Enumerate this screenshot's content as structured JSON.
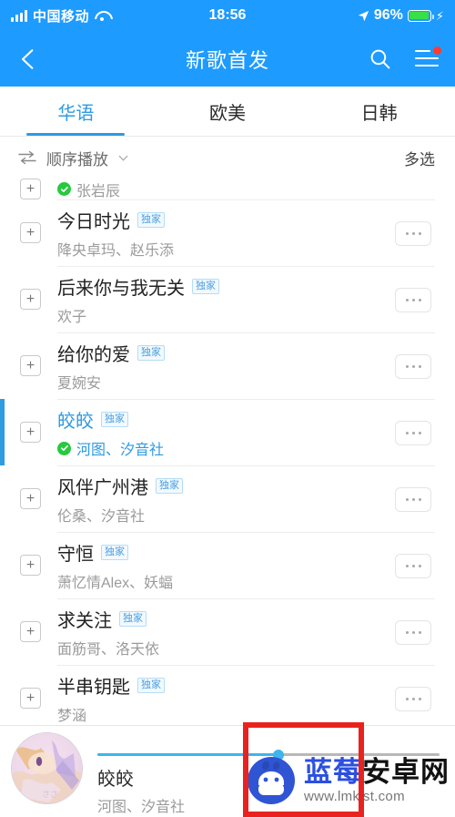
{
  "status_bar": {
    "signal_icon": "signal-bars-icon",
    "carrier": "中国移动",
    "wifi_icon": "wifi-icon",
    "time": "18:56",
    "location_icon": "location-arrow-icon",
    "battery_percent": "96%",
    "battery_level": 96,
    "battery_icon": "battery-icon",
    "charging_icon": "charging-bolt-icon"
  },
  "header": {
    "back_icon": "back-chevron-icon",
    "title": "新歌首发",
    "search_icon": "search-icon",
    "menu_icon": "hamburger-menu-icon",
    "menu_badge": true,
    "background_color": "#1e9bff"
  },
  "tabs": {
    "active_index": 0,
    "items": [
      {
        "label": "华语"
      },
      {
        "label": "欧美"
      },
      {
        "label": "日韩"
      }
    ],
    "active_color": "#2f9be0"
  },
  "toolbar": {
    "sequence_icon": "sequential-play-icon",
    "play_mode": "顺序播放",
    "caret_icon": "chevron-down-icon",
    "multi_select": "多选"
  },
  "list": {
    "partial_top_row": {
      "artist": "张岩辰",
      "verified": true
    },
    "badge_label": "独家",
    "add_icon": "plus-icon",
    "more_icon": "more-horizontal-icon",
    "songs": [
      {
        "title": "今日时光",
        "artist": "降央卓玛、赵乐添",
        "exclusive": true,
        "verified": false,
        "playing": false
      },
      {
        "title": "后来你与我无关",
        "artist": "欢子",
        "exclusive": true,
        "verified": false,
        "playing": false
      },
      {
        "title": "给你的爱",
        "artist": "夏婉安",
        "exclusive": true,
        "verified": false,
        "playing": false
      },
      {
        "title": "皎皎",
        "artist": "河图、汐音社",
        "exclusive": true,
        "verified": true,
        "playing": true
      },
      {
        "title": "风伴广州港",
        "artist": "伦桑、汐音社",
        "exclusive": true,
        "verified": false,
        "playing": false
      },
      {
        "title": "守恒",
        "artist": "萧忆情Alex、妖蝠",
        "exclusive": true,
        "verified": false,
        "playing": false
      },
      {
        "title": "求关注",
        "artist": "面筋哥、洛天依",
        "exclusive": true,
        "verified": false,
        "playing": false
      },
      {
        "title": "半串钥匙",
        "artist": "梦涵",
        "exclusive": true,
        "verified": false,
        "playing": false
      }
    ]
  },
  "player": {
    "album_art": "album-art-thumbnail",
    "title": "皎皎",
    "artist": "河图、汐音社",
    "progress_percent": 53,
    "progress_color": "#3cb6ec",
    "track_color": "#b8b8b8"
  },
  "watermark": {
    "logo_icon": "android-mascot-icon",
    "brand_blue": "蓝莓",
    "brand_black": "安卓网",
    "url": "www.lmkjst.com"
  },
  "annotation": {
    "shape": "red-rectangle-highlight",
    "color": "#e8231f"
  }
}
